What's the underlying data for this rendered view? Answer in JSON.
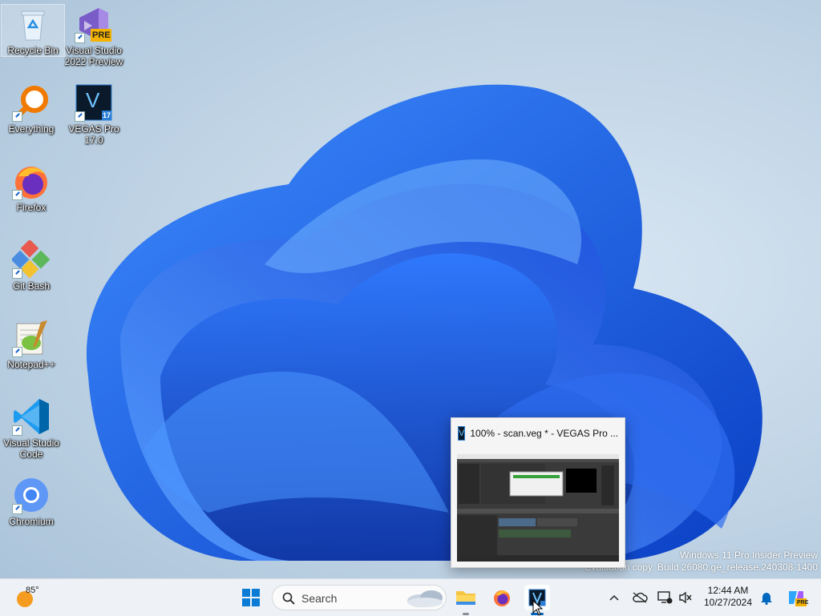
{
  "desktop": {
    "icons": [
      {
        "label": "Recycle Bin",
        "line2": ""
      },
      {
        "label": "Visual Studio",
        "line2": "2022 Preview"
      },
      {
        "label": "Everything",
        "line2": ""
      },
      {
        "label": "VEGAS Pro",
        "line2": "17.0"
      },
      {
        "label": "Firefox",
        "line2": ""
      },
      {
        "label": "Git Bash",
        "line2": ""
      },
      {
        "label": "Notepad++",
        "line2": ""
      },
      {
        "label": "Visual Studio",
        "line2": "Code"
      },
      {
        "label": "Chromium",
        "line2": ""
      }
    ],
    "vs_badge": "PRE",
    "vegas_badge": "17",
    "vegas_letter": "V"
  },
  "watermark": {
    "line1": "Windows 11 Pro Insider Preview",
    "line2": "Evaluation copy. Build 26080.ge_release.240308-1400"
  },
  "thumbnail": {
    "title": "100% - scan.veg * - VEGAS Pro ..."
  },
  "taskbar": {
    "weather_temp": "85°",
    "search_placeholder": "Search",
    "clock_time": "12:44 AM",
    "clock_date": "10/27/2024",
    "copilot_badge": "PRE"
  },
  "colors": {
    "accent": "#0067c0",
    "wallpaper_blue": "#1a5fe0",
    "taskbar_bg": "#eef2f6"
  }
}
